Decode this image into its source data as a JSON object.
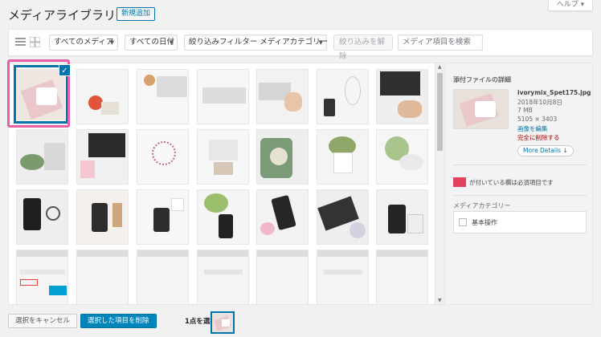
{
  "header": {
    "title": "メディアライブラリ",
    "add_new": "新規追加",
    "help": "ヘルプ ▾"
  },
  "toolbar": {
    "filter_media": "すべてのメディア",
    "filter_date": "すべての日付",
    "filter_category": "絞り込みフィルター メディアカテゴリー",
    "clear_filter": "絞り込みを解除",
    "search_placeholder": "メディア項目を検索"
  },
  "details": {
    "heading": "添付ファイルの詳細",
    "filename": "ivorymix_Spet175.jpg",
    "date": "2018年10月8日",
    "size": "7 MB",
    "dimensions": "5105 × 3403",
    "edit_image": "画像を編集",
    "delete_permanently": "完全に削除する",
    "more_details": "More Details ↓",
    "required_note": "が付いている欄は必須項目です",
    "media_category_label": "メディアカテゴリー",
    "category_option": "基本操作"
  },
  "bottom": {
    "cancel": "選択をキャンセル",
    "delete": "選択した項目を削除",
    "count": "1点を選択済"
  },
  "colors": {
    "accent": "#0073aa",
    "primary_button": "#0085ba",
    "required": "#e4405f",
    "highlight": "#e85ea7"
  }
}
